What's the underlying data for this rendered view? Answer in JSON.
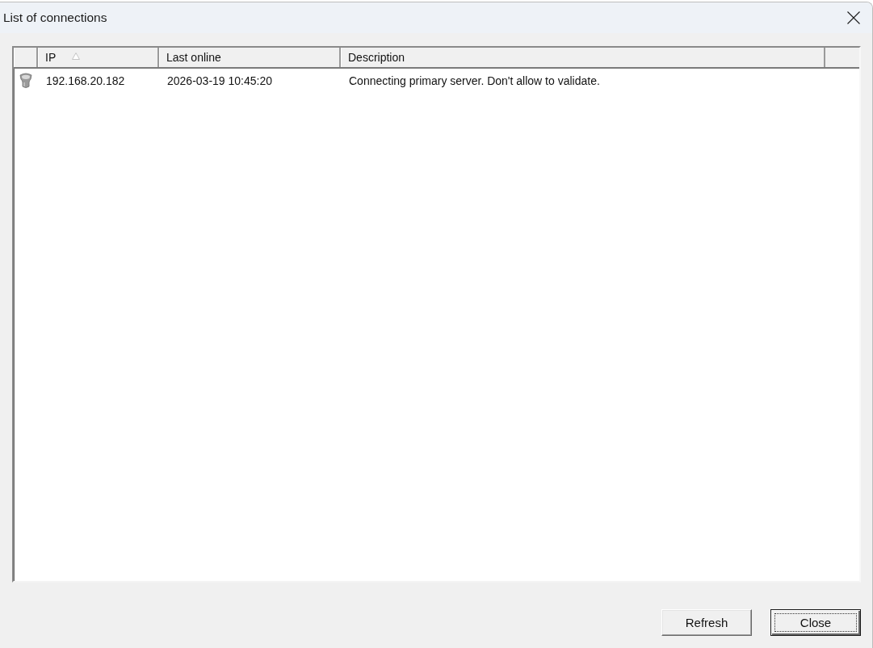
{
  "window": {
    "title": "List of connections"
  },
  "table": {
    "columns": [
      {
        "label": "IP",
        "sorted": true
      },
      {
        "label": "Last online",
        "sorted": false
      },
      {
        "label": "Description",
        "sorted": false
      }
    ],
    "rows": [
      {
        "selected": false,
        "cells": [
          "192.168.20.182",
          "2026-03-19 10:45:20",
          "Connecting primary server. Don't allow to validate."
        ]
      }
    ]
  },
  "buttons": [
    {
      "label": "Refresh",
      "default": false
    },
    {
      "label": "Close",
      "default": true
    }
  ]
}
